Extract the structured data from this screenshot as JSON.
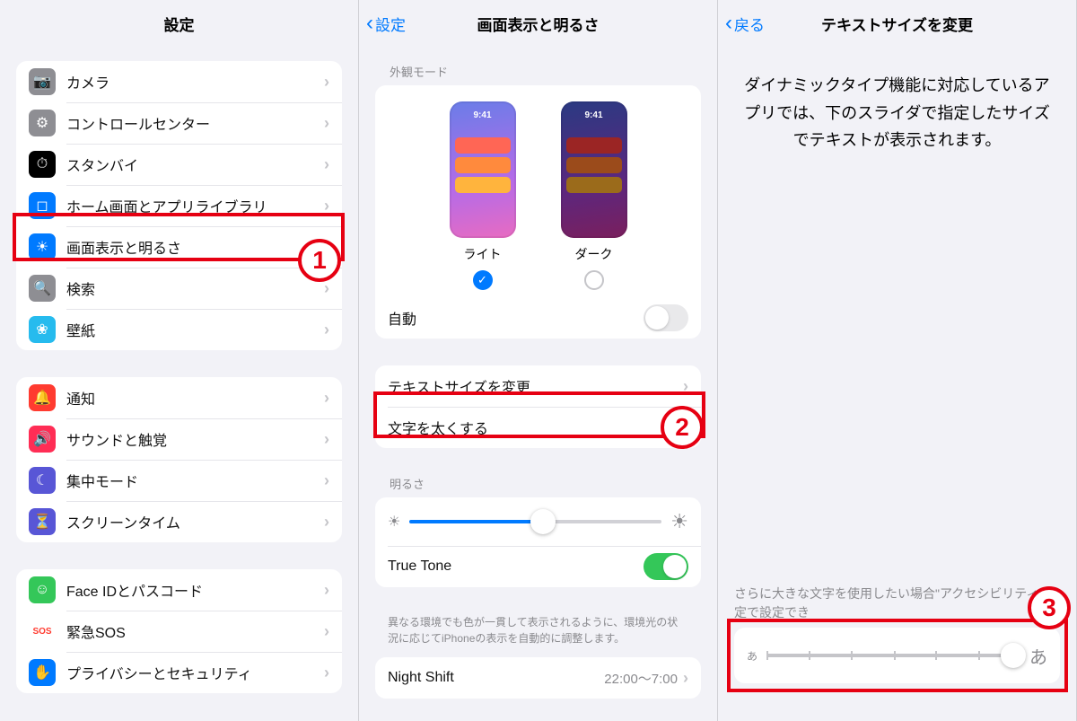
{
  "panel1": {
    "title": "設定",
    "group1": [
      {
        "label": "カメラ",
        "iconColor": "#8e8e93",
        "glyph": "📷"
      },
      {
        "label": "コントロールセンター",
        "iconColor": "#8e8e93",
        "glyph": "⚙"
      },
      {
        "label": "スタンバイ",
        "iconColor": "#000",
        "glyph": "⏱"
      },
      {
        "label": "ホーム画面とアプリライブラリ",
        "iconColor": "#007aff",
        "glyph": "◻"
      },
      {
        "label": "画面表示と明るさ",
        "iconColor": "#007aff",
        "glyph": "☀"
      },
      {
        "label": "検索",
        "iconColor": "#8e8e93",
        "glyph": "🔍"
      },
      {
        "label": "壁紙",
        "iconColor": "#26bbee",
        "glyph": "❀"
      }
    ],
    "group2": [
      {
        "label": "通知",
        "iconColor": "#ff3b30",
        "glyph": "🔔"
      },
      {
        "label": "サウンドと触覚",
        "iconColor": "#ff2d55",
        "glyph": "🔊"
      },
      {
        "label": "集中モード",
        "iconColor": "#5856d6",
        "glyph": "☾"
      },
      {
        "label": "スクリーンタイム",
        "iconColor": "#5856d6",
        "glyph": "⏳"
      }
    ],
    "group3": [
      {
        "label": "Face IDとパスコード",
        "iconColor": "#34c759",
        "glyph": "☺"
      },
      {
        "label": "緊急SOS",
        "iconColor": "#fff",
        "textColor": "#ff3b30",
        "glyph": "SOS"
      },
      {
        "label": "プライバシーとセキュリティ",
        "iconColor": "#007aff",
        "glyph": "✋"
      }
    ]
  },
  "panel2": {
    "back": "設定",
    "title": "画面表示と明るさ",
    "appearance_header": "外観モード",
    "light": "ライト",
    "dark": "ダーク",
    "thumb_time": "9:41",
    "auto": "自動",
    "text_size": "テキストサイズを変更",
    "bold_text": "文字を太くする",
    "brightness_header": "明るさ",
    "true_tone": "True Tone",
    "true_tone_note": "異なる環境でも色が一貫して表示されるように、環境光の状況に応じてiPhoneの表示を自動的に調整します。",
    "night_shift": "Night Shift",
    "night_shift_value": "22:00〜7:00"
  },
  "panel3": {
    "back": "戻る",
    "title": "テキストサイズを変更",
    "desc": "ダイナミックタイプ機能に対応しているアプリでは、下のスライダで指定したサイズでテキストが表示されます。",
    "note": "さらに大きな文字を使用したい場合\"アクセシビリティ\"設定で設定でき",
    "small": "あ",
    "large": "あ"
  },
  "badges": {
    "b1": "1",
    "b2": "2",
    "b3": "3"
  }
}
